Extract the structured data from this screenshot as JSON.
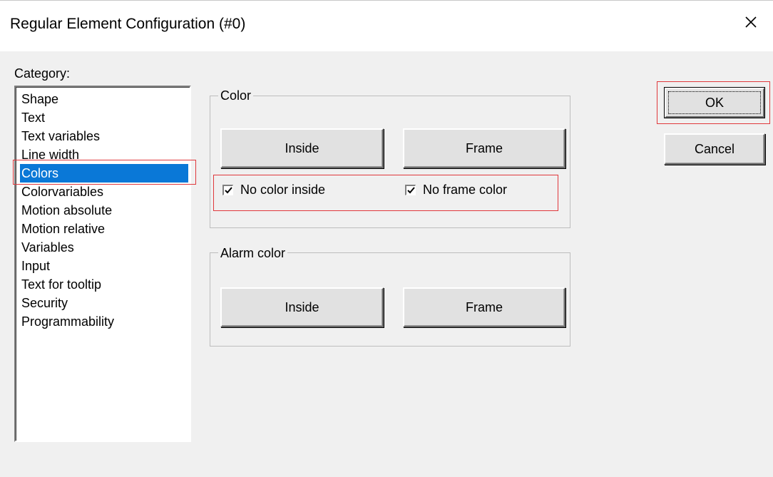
{
  "window": {
    "title": "Regular Element Configuration (#0)"
  },
  "category": {
    "label": "Category:",
    "items": [
      "Shape",
      "Text",
      "Text variables",
      "Line width",
      "Colors",
      "Colorvariables",
      "Motion absolute",
      "Motion relative",
      "Variables",
      "Input",
      "Text for tooltip",
      "Security",
      "Programmability"
    ],
    "selected": "Colors"
  },
  "color_group": {
    "label": "Color",
    "inside_label": "Inside",
    "frame_label": "Frame",
    "no_color_inside": {
      "label": "No color inside",
      "checked": true
    },
    "no_frame_color": {
      "label": "No frame color",
      "checked": true
    }
  },
  "alarm_group": {
    "label": "Alarm color",
    "inside_label": "Inside",
    "frame_label": "Frame"
  },
  "buttons": {
    "ok": "OK",
    "cancel": "Cancel"
  },
  "colors": {
    "selection": "#0a78d7",
    "highlight": "#e0383c"
  },
  "icons": {
    "close": "close-icon",
    "check": "check-icon"
  }
}
